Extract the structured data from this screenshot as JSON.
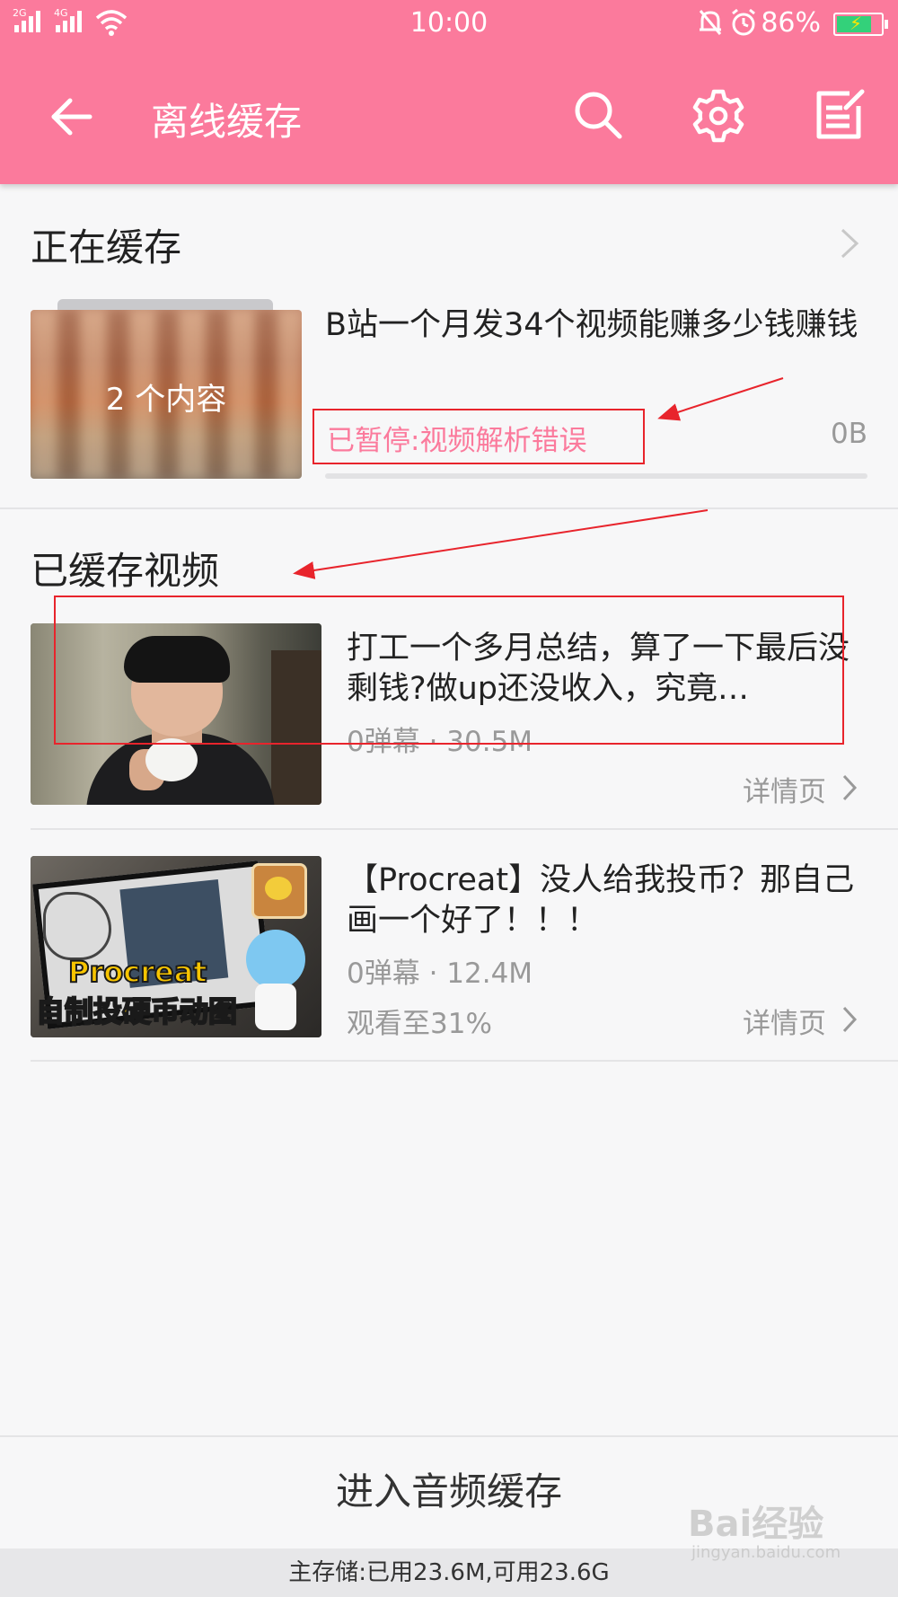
{
  "status_bar": {
    "sim1": "2G",
    "sim2": "4G",
    "time": "10:00",
    "battery_percent": "86%",
    "battery_level": 0.86,
    "icons": [
      "signal-icon",
      "signal-icon",
      "wifi-icon",
      "bell-muted-icon",
      "alarm-icon",
      "battery-charging-icon"
    ]
  },
  "app_bar": {
    "title": "离线缓存",
    "icons": [
      "back-arrow-icon",
      "search-icon",
      "settings-gear-icon",
      "edit-list-icon"
    ]
  },
  "downloading": {
    "heading": "正在缓存",
    "item": {
      "count_label": "2 个内容",
      "title": "B站一个月发34个视频能赚多少钱赚钱",
      "status": "已暂停:视频解析错误",
      "size": "0B",
      "progress": 0
    }
  },
  "cached": {
    "heading": "已缓存视频",
    "items": [
      {
        "title": "打工一个多月总结，算了一下最后没剩钱?做up还没收入，究竟…",
        "meta": "0弹幕 · 30.5M",
        "watched": "",
        "detail": "详情页"
      },
      {
        "title": "【Procreat】没人给我投币？那自己画一个好了！！！",
        "meta": "0弹幕 · 12.4M",
        "watched": "观看至31%",
        "detail": "详情页",
        "thumb_caption_1": "Procreat",
        "thumb_caption_2": "自制投硬币动图"
      }
    ]
  },
  "footer": {
    "audio_button": "进入音频缓存",
    "storage": "主存储:已用23.6M,可用23.6G"
  },
  "watermark": {
    "brand": "Bai经验",
    "url": "jingyan.baidu.com"
  },
  "colors": {
    "accent": "#fb7a9c",
    "annotation": "#e8242c"
  }
}
